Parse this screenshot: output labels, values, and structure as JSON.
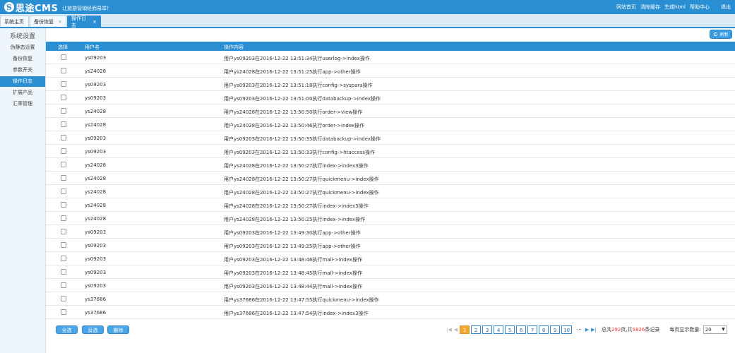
{
  "header": {
    "logo_mark": "S",
    "logo_text": "思途CMS",
    "slogan": "让旅游营销轻而易举！",
    "links": [
      "网站首页",
      "清除缓存",
      "生成html",
      "帮助中心"
    ],
    "logout": "退出"
  },
  "tabs": [
    {
      "label": "系统主页",
      "closable": false
    },
    {
      "label": "备份恢复",
      "closable": true
    },
    {
      "label": "操作日志",
      "closable": true,
      "active": true
    }
  ],
  "sidebar": {
    "title": "系统设置",
    "items": [
      "伪静态设置",
      "备份恢复",
      "参数开关",
      "操作日志",
      "扩展产品",
      "汇率管理"
    ],
    "active_index": 3
  },
  "toolbar": {
    "refresh_label": "刷新"
  },
  "table": {
    "headers": [
      "选择",
      "用户名",
      "操作内容"
    ],
    "rows": [
      {
        "user": "ys09203",
        "content": "用户ys09203在2016-12-22 13:51:34执行userlog->index操作"
      },
      {
        "user": "ys24028",
        "content": "用户ys24028在2016-12-22 13:51:25执行app->other操作"
      },
      {
        "user": "ys09203",
        "content": "用户ys09203在2016-12-22 13:51:18执行config->syspara操作"
      },
      {
        "user": "ys09203",
        "content": "用户ys09203在2016-12-22 13:51:00执行databackup->index操作"
      },
      {
        "user": "ys24028",
        "content": "用户ys24028在2016-12-22 13:50:50执行order->view操作"
      },
      {
        "user": "ys24028",
        "content": "用户ys24028在2016-12-22 13:50:46执行order->index操作"
      },
      {
        "user": "ys09203",
        "content": "用户ys09203在2016-12-22 13:50:35执行databackup->index操作"
      },
      {
        "user": "ys09203",
        "content": "用户ys09203在2016-12-22 13:50:33执行config->htaccess操作"
      },
      {
        "user": "ys24028",
        "content": "用户ys24028在2016-12-22 13:50:27执行index->index3操作"
      },
      {
        "user": "ys24028",
        "content": "用户ys24028在2016-12-22 13:50:27执行quickmenu->index操作"
      },
      {
        "user": "ys24028",
        "content": "用户ys24028在2016-12-22 13:50:27执行quickmenu->index操作"
      },
      {
        "user": "ys24028",
        "content": "用户ys24028在2016-12-22 13:50:27执行index->index3操作"
      },
      {
        "user": "ys24028",
        "content": "用户ys24028在2016-12-22 13:50:25执行index->index操作"
      },
      {
        "user": "ys09203",
        "content": "用户ys09203在2016-12-22 13:49:30执行app->other操作"
      },
      {
        "user": "ys09203",
        "content": "用户ys09203在2016-12-22 13:49:25执行app->other操作"
      },
      {
        "user": "ys09203",
        "content": "用户ys09203在2016-12-22 13:48:46执行mall->index操作"
      },
      {
        "user": "ys09203",
        "content": "用户ys09203在2016-12-22 13:48:45执行mall->index操作"
      },
      {
        "user": "ys09203",
        "content": "用户ys09203在2016-12-22 13:48:44执行mall->index操作"
      },
      {
        "user": "ys37686",
        "content": "用户ys37686在2016-12-22 13:47:55执行quickmenu->index操作"
      },
      {
        "user": "ys37686",
        "content": "用户ys37686在2016-12-22 13:47:54执行index->index3操作"
      }
    ]
  },
  "actions": {
    "select_all": "全选",
    "invert": "反选",
    "delete": "删除"
  },
  "pagination": {
    "pages": [
      "1",
      "2",
      "3",
      "4",
      "5",
      "6",
      "7",
      "8",
      "9",
      "10"
    ],
    "current": "1",
    "ellipsis": "···",
    "total_prefix": "总共",
    "total_pages": "292",
    "mid": "页,共",
    "total_records": "5826",
    "suffix": "条记录",
    "per_page_label": "每页显示数量:",
    "per_page_value": "20"
  },
  "colors": {
    "primary": "#2a8fd2",
    "current_page": "#f0a830",
    "highlight": "#e33"
  }
}
